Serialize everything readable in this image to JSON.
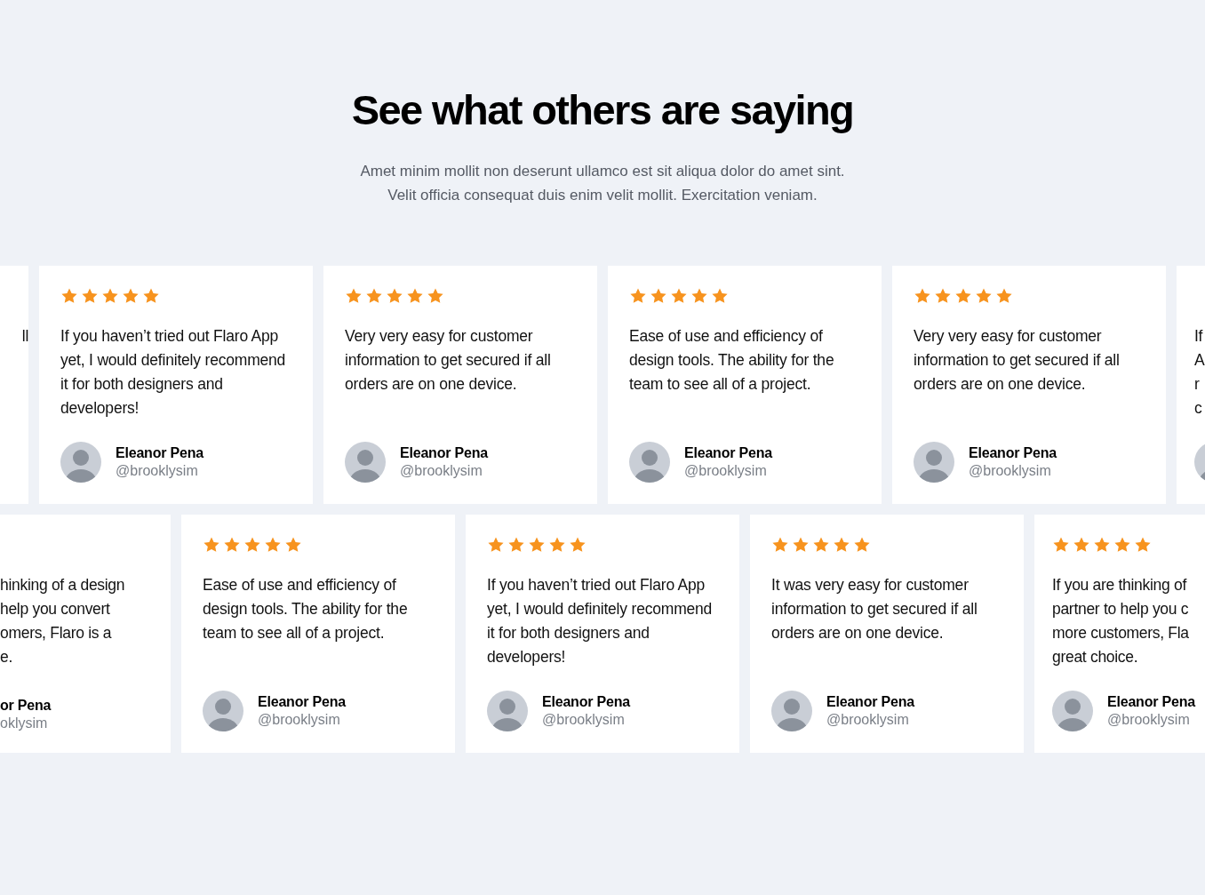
{
  "heading": "See what others are saying",
  "subheading": "Amet minim mollit non deserunt ullamco est sit aliqua dolor do amet sint. Velit officia consequat duis enim velit mollit. Exercitation veniam.",
  "rows": [
    {
      "cards": [
        {
          "kind": "partial-left",
          "lines": [
            "ll"
          ]
        },
        {
          "kind": "full",
          "stars": 5,
          "quote": "If you haven’t tried out Flaro App yet, I would definitely recommend it for both designers and developers!",
          "name": "Eleanor Pena",
          "handle": "@brooklysim"
        },
        {
          "kind": "full",
          "stars": 5,
          "quote": "Very very easy for customer information to get secured if all orders are on one device.",
          "name": "Eleanor Pena",
          "handle": "@brooklysim"
        },
        {
          "kind": "full",
          "stars": 5,
          "quote": "Ease of use and efficiency of design tools. The ability for the team to see all of a project.",
          "name": "Eleanor Pena",
          "handle": "@brooklysim"
        },
        {
          "kind": "full",
          "stars": 5,
          "quote": "Very very easy for customer information to get secured if all orders are on one device.",
          "name": "Eleanor Pena",
          "handle": "@brooklysim"
        },
        {
          "kind": "partial-right",
          "lines": [
            "If",
            "A",
            "r",
            "c"
          ]
        }
      ]
    },
    {
      "cards": [
        {
          "kind": "partial-left",
          "lines": [
            "hinking of a design",
            "help you convert",
            "omers, Flaro is a",
            "e."
          ],
          "name": "or Pena",
          "handle": "oklysim"
        },
        {
          "kind": "full",
          "stars": 5,
          "quote": "Ease of use and efficiency of design tools. The ability for the team to see all of a project.",
          "name": "Eleanor Pena",
          "handle": "@brooklysim"
        },
        {
          "kind": "full",
          "stars": 5,
          "quote": "If you haven’t tried out Flaro App yet, I would definitely recommend it for both designers and developers!",
          "name": "Eleanor Pena",
          "handle": "@brooklysim"
        },
        {
          "kind": "full",
          "stars": 5,
          "quote": "It was very easy for customer information to get secured if all orders are on one device.",
          "name": "Eleanor Pena",
          "handle": "@brooklysim"
        },
        {
          "kind": "partial-right",
          "stars": 5,
          "lines": [
            "If you are thinking of",
            "partner to help you c",
            "more customers, Fla",
            "great choice."
          ],
          "name": "Eleanor Pena",
          "handle": "@brooklysim"
        }
      ]
    }
  ]
}
